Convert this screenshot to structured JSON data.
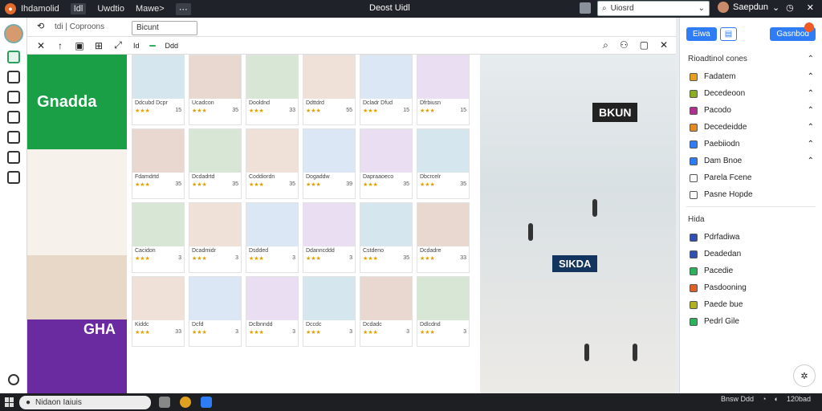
{
  "topbar": {
    "app_name": "Ihdamolid",
    "menu": [
      "Idl",
      "Uwdtio",
      "Mawe>",
      "⋯"
    ],
    "title": "Deost Uidl",
    "search_placeholder": "Uiosrd",
    "user_name": "Saepdun"
  },
  "toolbar": {
    "address": "tdi | Coproons",
    "filter_value": "Bicunt",
    "chip1": "Id",
    "chip2": "",
    "chip3": "Ddd"
  },
  "store_left": {
    "sign_top": "Gnadda",
    "sign_bottom": "GHA"
  },
  "products": [
    {
      "cap": "Ddcubd Dcpr",
      "rev": "15"
    },
    {
      "cap": "Ucadcon",
      "rev": "35"
    },
    {
      "cap": "Dooldnd",
      "rev": "33"
    },
    {
      "cap": "Ddttdrd",
      "rev": "55"
    },
    {
      "cap": "Dcladr Dfud",
      "rev": "15"
    },
    {
      "cap": "Dfrbiusn",
      "rev": "15"
    },
    {
      "cap": "Fdamdrtd",
      "rev": "35"
    },
    {
      "cap": "Dcdadrtd",
      "rev": "35"
    },
    {
      "cap": "Coddiordn",
      "rev": "35"
    },
    {
      "cap": "Dogaddw",
      "rev": "39"
    },
    {
      "cap": "Dapraaoeco",
      "rev": "35"
    },
    {
      "cap": "Dbcrcelr",
      "rev": "35"
    },
    {
      "cap": "Cacidon",
      "rev": "3"
    },
    {
      "cap": "Dcadmidr",
      "rev": "3"
    },
    {
      "cap": "Dsdded",
      "rev": "3"
    },
    {
      "cap": "Ddanncddd",
      "rev": "3"
    },
    {
      "cap": "Cstdeno",
      "rev": "35"
    },
    {
      "cap": "Dcdadre",
      "rev": "33"
    },
    {
      "cap": "Kiddc",
      "rev": "33"
    },
    {
      "cap": "Dcfd",
      "rev": "3"
    },
    {
      "cap": "Dclbnndd",
      "rev": "3"
    },
    {
      "cap": "Dccdc",
      "rev": "3"
    },
    {
      "cap": "Dcdadc",
      "rev": "3"
    },
    {
      "cap": "Ddlcdnd",
      "rev": "3"
    }
  ],
  "mall": {
    "brand_upper": "BKUN",
    "brand_lower": "SIKDA"
  },
  "right_panel": {
    "btn1": "Eiwa",
    "btn2": "Gasnbod",
    "section1_title": "Rioadtinol cones",
    "items1": [
      {
        "label": "Fadatem",
        "color": "#e6a020"
      },
      {
        "label": "Decedeoon",
        "color": "#88b020"
      },
      {
        "label": "Pacodo",
        "color": "#b03090"
      },
      {
        "label": "Decedeidde",
        "color": "#e08c20"
      },
      {
        "label": "Paebiiodn",
        "color": "#2f7df6"
      },
      {
        "label": "Dam Bnoe",
        "color": "#2f7df6"
      },
      {
        "label": "Parela Fcene",
        "color": "#ffffff"
      },
      {
        "label": "Pasne Hopde",
        "color": "#ffffff"
      }
    ],
    "section2_title": "Hida",
    "items2": [
      {
        "label": "Pdrfadiwa",
        "color": "#2f4fb5"
      },
      {
        "label": "Deadedan",
        "color": "#2f4fb5"
      },
      {
        "label": "Pacedie",
        "color": "#2db35e"
      },
      {
        "label": "Pasdooning",
        "color": "#e0602a"
      },
      {
        "label": "Paede bue",
        "color": "#b0b020"
      },
      {
        "label": "Pedrl Gile",
        "color": "#2db35e"
      }
    ]
  },
  "taskbar": {
    "search": "Nidaon Iaiuis",
    "tray_left": "Bnsw Ddd",
    "clock": "120bad"
  }
}
